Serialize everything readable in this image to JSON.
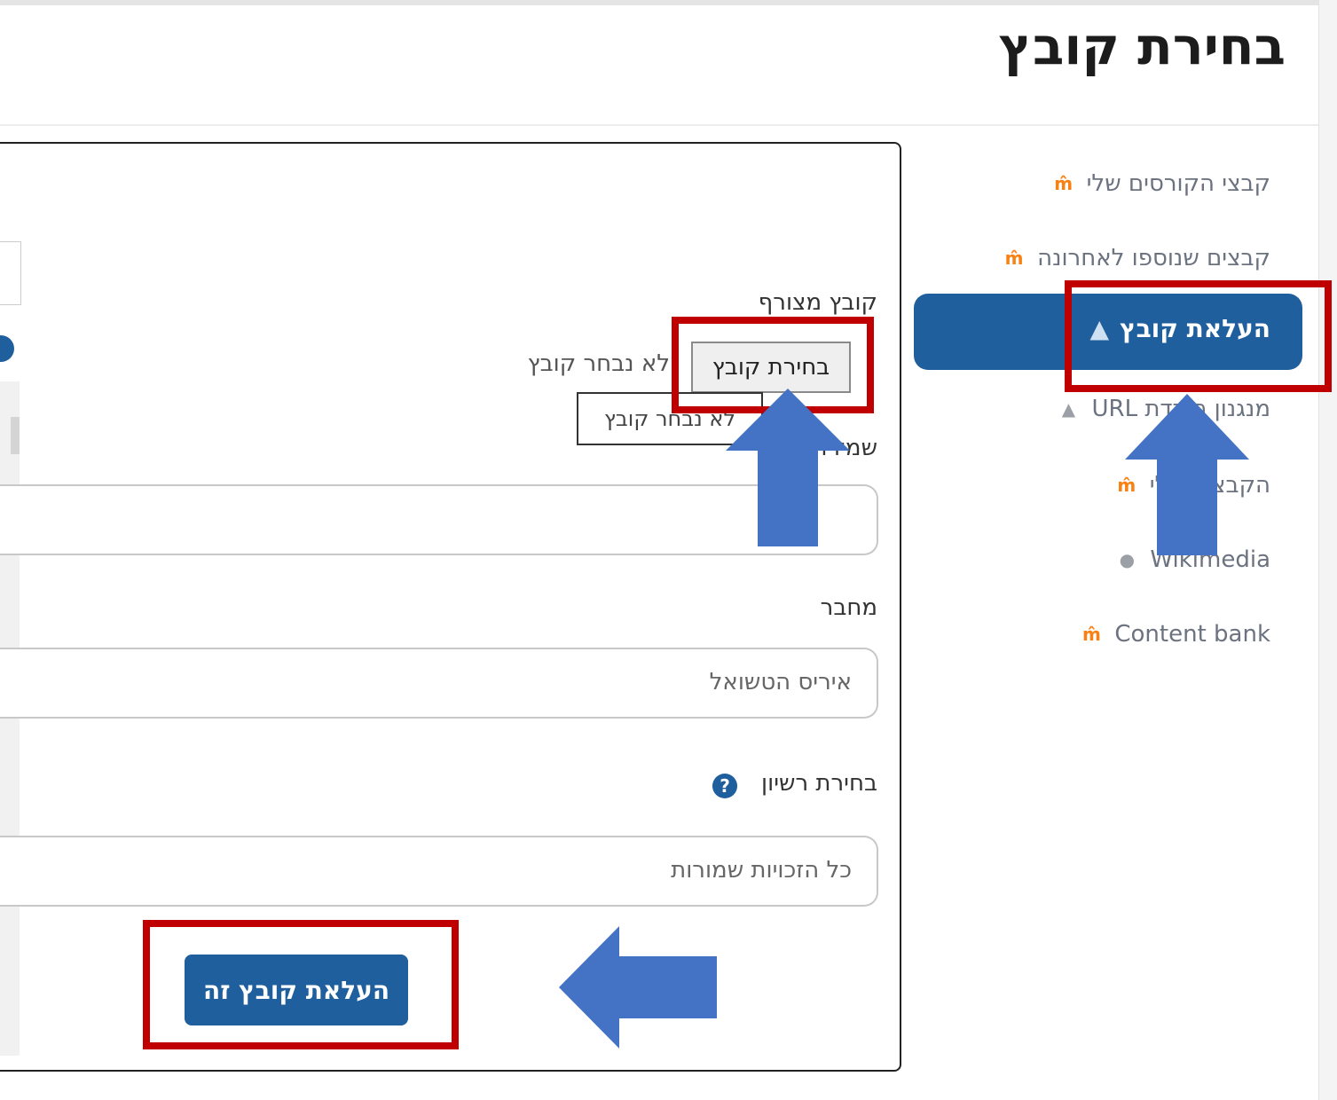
{
  "dialog": {
    "title": "בחירת קובץ"
  },
  "sidebar": {
    "items": [
      {
        "label": "קבצי הקורסים שלי",
        "icon": "moodle-icon"
      },
      {
        "label": "קבצים שנוספו לאחרונה",
        "icon": "moodle-icon"
      },
      {
        "label": "העלאת קובץ",
        "icon": "upload-icon",
        "active": true
      },
      {
        "label": "מנגנון הורדת URL",
        "icon": "download-icon"
      },
      {
        "label": "הקבצים שלי",
        "icon": "moodle-icon"
      },
      {
        "label": "Wikimedia",
        "icon": "globe-icon"
      },
      {
        "label": "Content bank",
        "icon": "moodle-icon"
      }
    ]
  },
  "form": {
    "attachment_label": "קובץ מצורף",
    "choose_file_button": "בחירת קובץ",
    "no_file_text": "לא נבחר קובץ",
    "tooltip_text": "לא נבחר קובץ",
    "save_as_label": "שמירה בשם",
    "save_as_value": "",
    "author_label": "מחבר",
    "author_value": "איריס הטשואל",
    "license_label": "בחירת רשיון",
    "license_value": "כל הזכויות שמורות",
    "upload_button": "העלאת קובץ זה"
  },
  "colors": {
    "accent": "#1f5f9e",
    "annotation_red": "#c00000",
    "annotation_arrow": "#4472c4",
    "moodle_orange": "#f98012"
  }
}
